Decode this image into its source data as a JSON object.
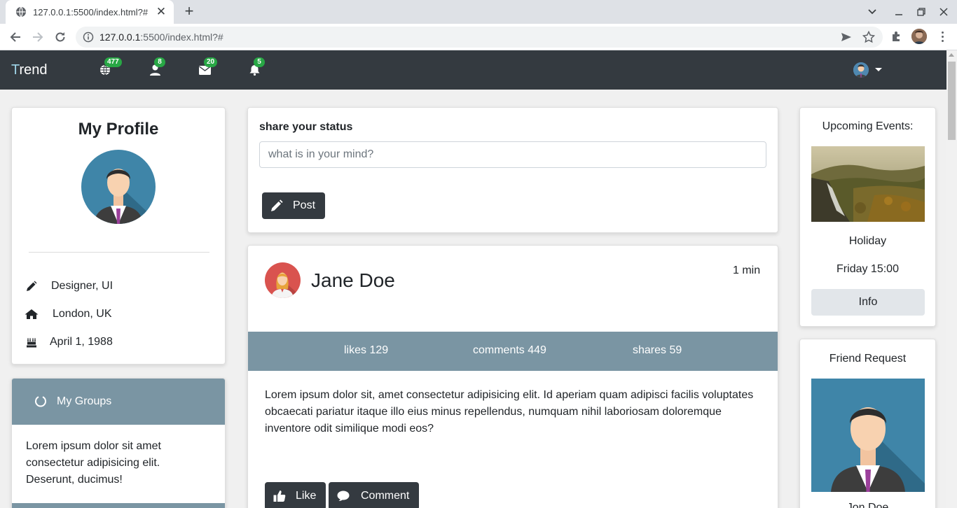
{
  "browser": {
    "tab_title": "127.0.0.1:5500/index.html?#",
    "tab_close": "✕",
    "new_tab": "+",
    "url_host": "127.0.0.1",
    "url_rest": ":5500/index.html?#"
  },
  "navbar": {
    "brand_first": "T",
    "brand_rest": "rend",
    "badges": {
      "globe": "477",
      "user": "8",
      "envelope": "20",
      "bell": "5"
    }
  },
  "profile": {
    "title": "My Profile",
    "job": "Designer, UI",
    "location": "London, UK",
    "birthday": "April 1, 1988"
  },
  "groups": {
    "title": "My Groups",
    "body": "Lorem ipsum dolor sit amet consectetur adipisicing elit. Deserunt, ducimus!"
  },
  "status": {
    "label": "share your status",
    "placeholder": "what is in your mind?",
    "post_button": "Post"
  },
  "post": {
    "author": "Jane Doe",
    "time": "1 min",
    "likes": "likes 129",
    "comments": "comments 449",
    "shares": "shares 59",
    "text": "Lorem ipsum dolor sit, amet consectetur adipisicing elit. Id aperiam quam adipisci facilis voluptates obcaecati pariatur itaque illo eius minus repellendus, numquam nihil laboriosam doloremque inventore odit similique modi eos?",
    "like_button": "Like",
    "comment_button": "Comment"
  },
  "events": {
    "title": "Upcoming Events:",
    "name": "Holiday",
    "time": "Friday 15:00",
    "info_button": "Info"
  },
  "friend": {
    "title": "Friend Request",
    "name": "Jon Doe"
  },
  "colors": {
    "navbar": "#343a40",
    "accent_panel": "#7a95a3",
    "badge": "#28a745",
    "button_dark": "#343a40",
    "button_light": "#e2e6ea"
  },
  "icons": [
    "globe-icon",
    "user-icon",
    "envelope-icon",
    "bell-icon",
    "pencil-icon",
    "home-icon",
    "cake-icon",
    "circle-notch-icon",
    "thumbs-up-icon",
    "comment-icon"
  ]
}
